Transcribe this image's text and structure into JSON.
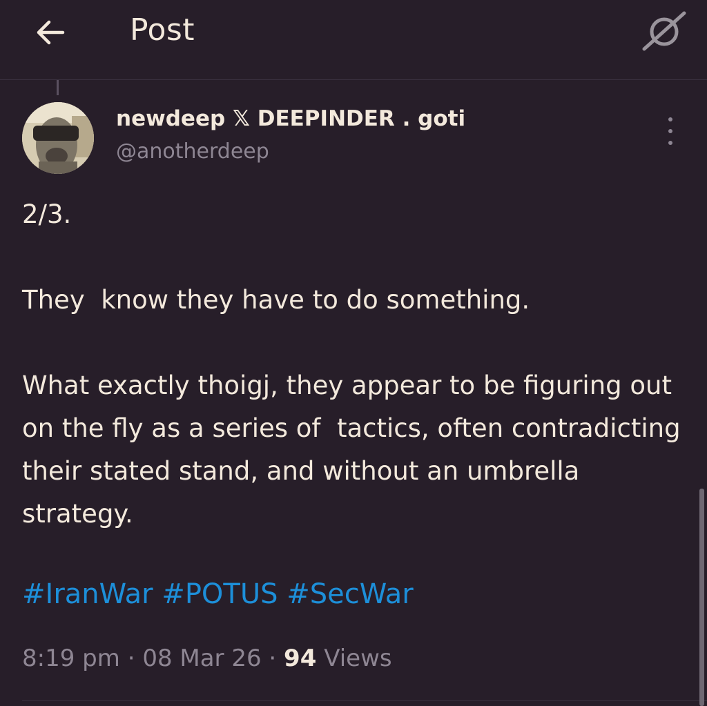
{
  "header": {
    "title": "Post",
    "back_icon": "arrow-left-icon",
    "grok_icon": "grok-icon"
  },
  "author": {
    "display_name": "newdeep 𝕏 DEEPINDER . goti",
    "handle": "@anotherdeep"
  },
  "post": {
    "paragraphs": [
      "2/3.",
      "They  know they have to do something.",
      "What exactly thoigj, they appear to be figuring out on the fly as a series of  tactics, often contradicting their stated stand, and without an umbrella strategy."
    ],
    "hashtags": [
      "#IranWar",
      "#POTUS",
      "#SecWar"
    ],
    "time": "8:19 pm",
    "date": "08 Mar 26",
    "views_count": "94",
    "views_label": "Views",
    "separator": "·"
  },
  "colors": {
    "background": "#271e29",
    "text": "#f3e9dc",
    "muted": "#8e8693",
    "hashtag": "#1d8fd9"
  }
}
